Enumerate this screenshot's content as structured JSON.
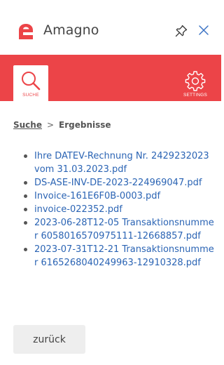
{
  "header": {
    "app_name": "Amagno",
    "brand_color": "#ec4448"
  },
  "icons": {
    "logo": "amagno-logo-icon",
    "pin": "pin-icon",
    "close": "close-icon",
    "search": "search-icon",
    "settings": "gear-icon"
  },
  "toolbar": {
    "tabs": [
      {
        "label": "SUCHE",
        "active": true
      },
      {
        "label": "SETTINGS",
        "active": false
      }
    ]
  },
  "breadcrumb": {
    "root": "Suche",
    "separator": ">",
    "current": "Ergebnisse"
  },
  "results": [
    "Ihre DATEV-Rechnung Nr. 2429232023 vom 31.03.2023.pdf",
    "DS-ASE-INV-DE-2023-224969047.pdf",
    "Invoice-161E6F0B-0003.pdf",
    "invoice-022352.pdf",
    "2023-06-28T12-05 Transaktionsnummer 6058016570975111-12668857.pdf",
    "2023-07-31T12-21 Transaktionsnummer 6165268040249963-12910328.pdf"
  ],
  "back_button": "zurück"
}
